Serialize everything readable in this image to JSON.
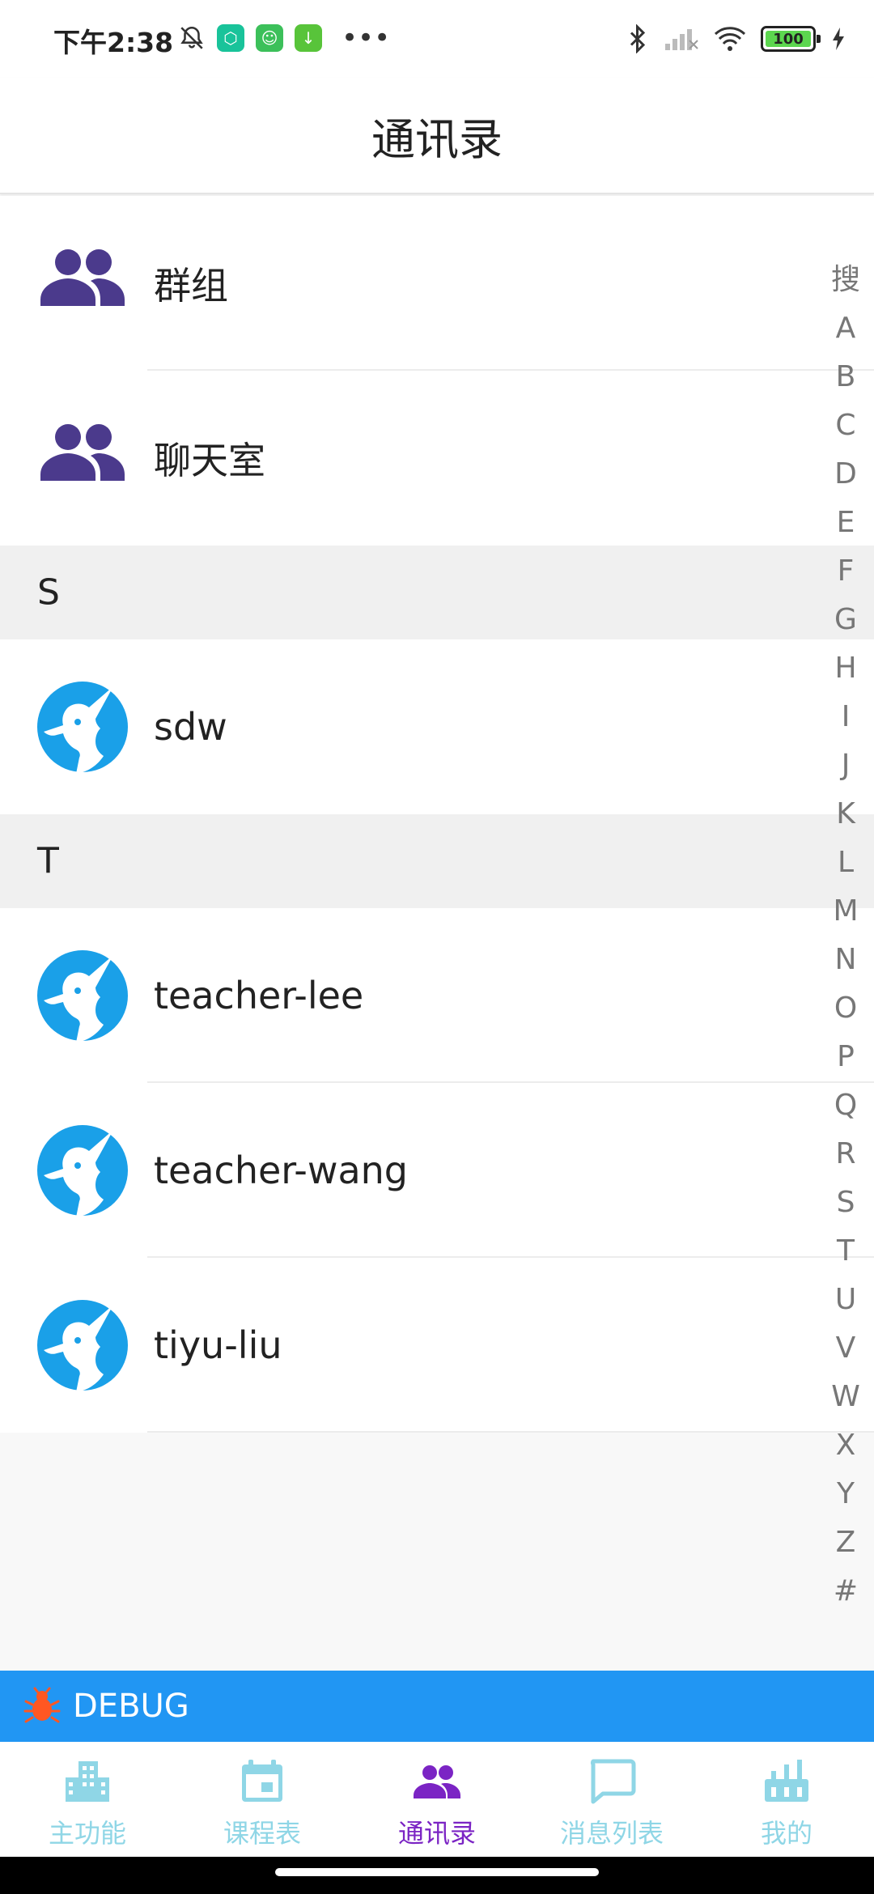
{
  "status_bar": {
    "time": "下午2:38",
    "battery": "100"
  },
  "header": {
    "title": "通讯录"
  },
  "groups": [
    {
      "label": "群组"
    },
    {
      "label": "聊天室"
    }
  ],
  "sections": [
    {
      "letter": "S",
      "contacts": [
        {
          "name": "sdw"
        }
      ]
    },
    {
      "letter": "T",
      "contacts": [
        {
          "name": "teacher-lee"
        },
        {
          "name": "teacher-wang"
        },
        {
          "name": "tiyu-liu"
        }
      ]
    }
  ],
  "index_bar": [
    "搜",
    "A",
    "B",
    "C",
    "D",
    "E",
    "F",
    "G",
    "H",
    "I",
    "J",
    "K",
    "L",
    "M",
    "N",
    "O",
    "P",
    "Q",
    "R",
    "S",
    "T",
    "U",
    "V",
    "W",
    "X",
    "Y",
    "Z",
    "#"
  ],
  "debug_bar": {
    "label": "DEBUG"
  },
  "tabs": [
    {
      "label": "主功能",
      "icon": "building-icon"
    },
    {
      "label": "课程表",
      "icon": "calendar-icon"
    },
    {
      "label": "通讯录",
      "icon": "contacts-icon",
      "active": true
    },
    {
      "label": "消息列表",
      "icon": "chat-bubble-icon"
    },
    {
      "label": "我的",
      "icon": "profile-icon"
    }
  ],
  "colors": {
    "accent_active": "#7b24c4",
    "tab_inactive": "#8fd6e6",
    "debug_bar": "#2196f3",
    "group_icon": "#4b3a8c",
    "avatar": "#1aa0e8"
  }
}
